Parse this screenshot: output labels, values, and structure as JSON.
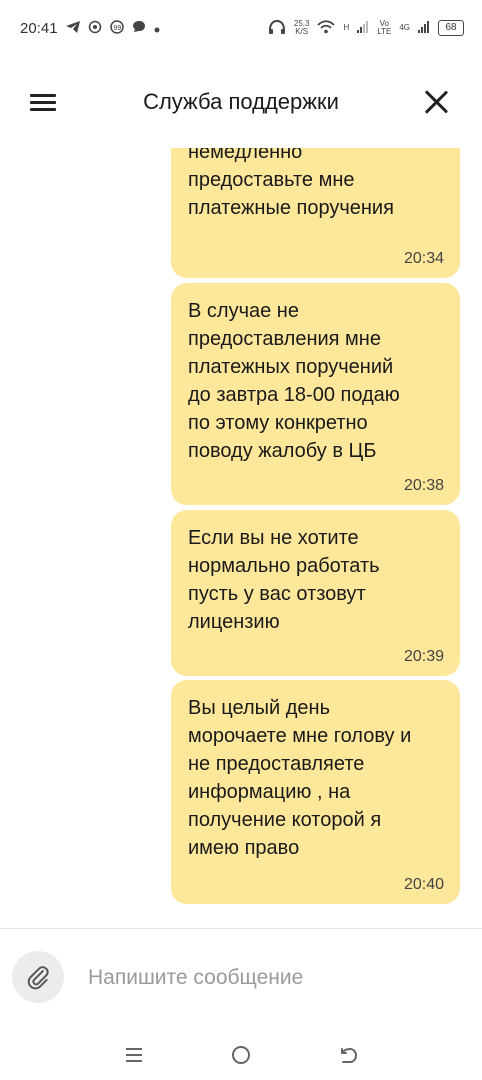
{
  "status_bar": {
    "time": "20:41",
    "net_speed": "25,3",
    "net_unit": "K/S",
    "signal_h": "H",
    "volte": "Vo\nLTE",
    "network_type": "4G",
    "battery": "68",
    "icons": [
      "telegram-icon",
      "vpn-icon",
      "quote-icon",
      "chat-icon",
      "dot-icon",
      "headphones-icon",
      "wifi-icon",
      "signal-icon"
    ]
  },
  "header": {
    "title": "Служба поддержки",
    "menu_icon": "hamburger-menu-icon",
    "close_icon": "close-icon"
  },
  "messages": [
    {
      "text": "немедленно\nпредоставьте мне\nплатежные поручения",
      "time": "20:34"
    },
    {
      "text": "В случае не\nпредоставления мне\nплатежных поручений\nдо завтра 18-00 подаю\nпо этому конкретно\nповоду жалобу в ЦБ",
      "time": "20:38"
    },
    {
      "text": "Если вы не хотите\nнормально работать\nпусть у вас отзовут\nлицензию",
      "time": "20:39"
    },
    {
      "text": "Вы целый день\nморочаете мне голову и\nне предоставляете\nинформацию , на\nполучение которой я\nимею право",
      "time": "20:40"
    }
  ],
  "composer": {
    "placeholder": "Напишите сообщение",
    "attach_icon": "paperclip-icon"
  },
  "colors": {
    "bubble": "#fde79a",
    "background": "#ffffff"
  },
  "nav": [
    "recent-apps-icon",
    "home-icon",
    "back-icon"
  ]
}
